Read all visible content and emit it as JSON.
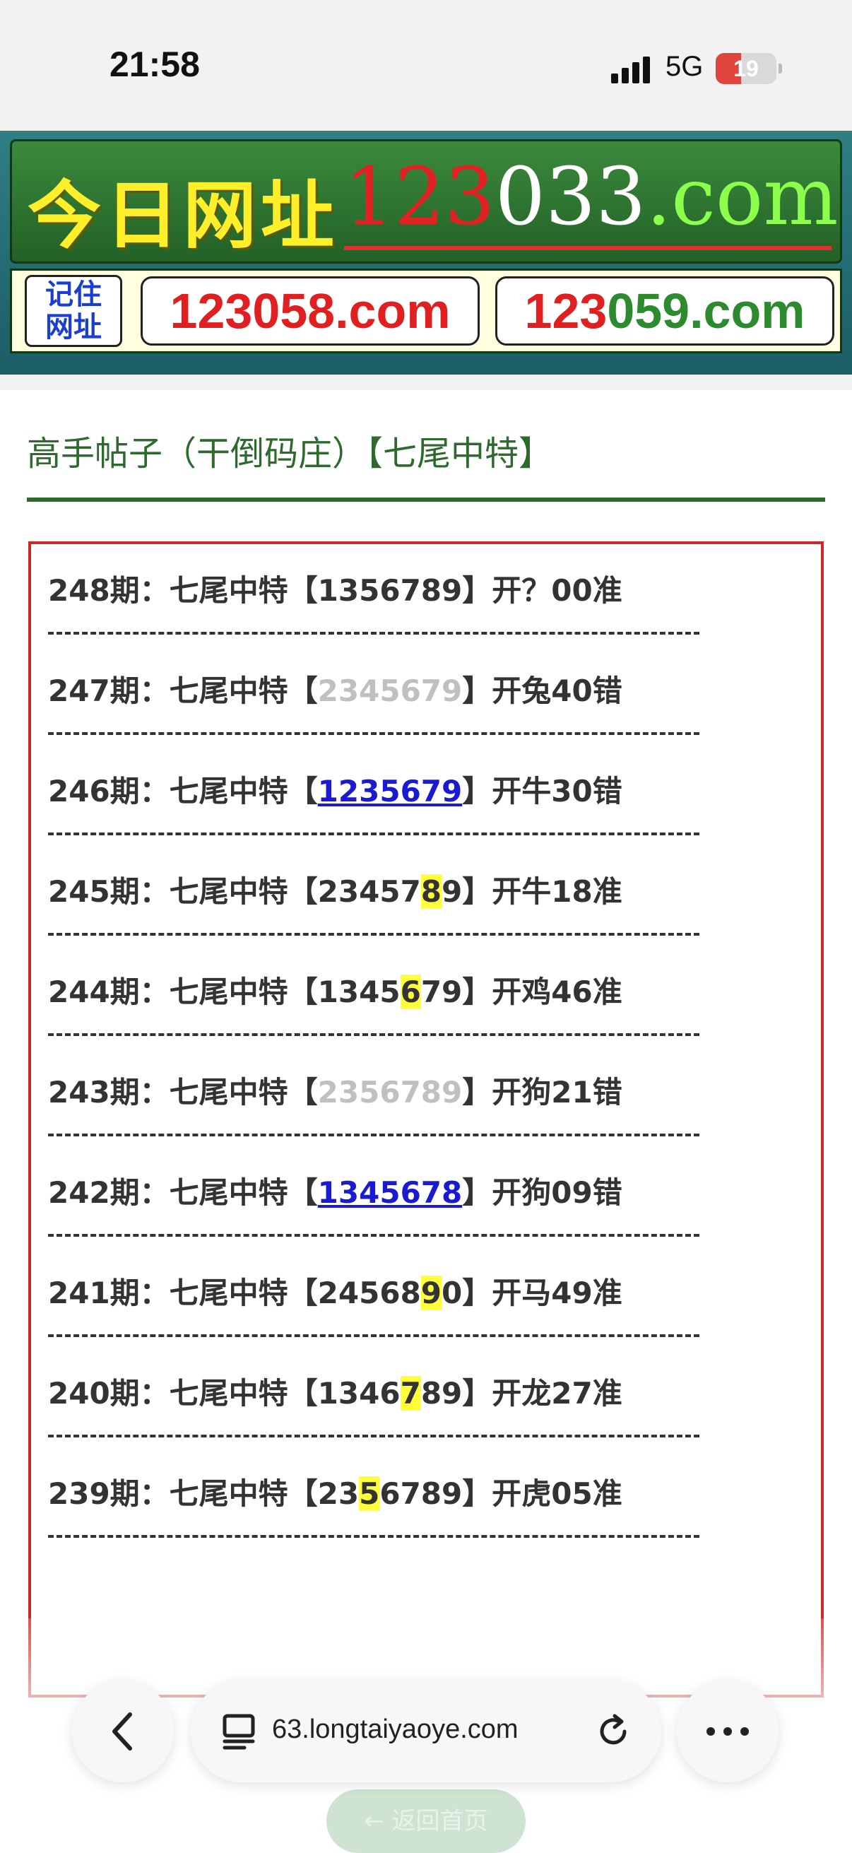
{
  "status_bar": {
    "time": "21:58",
    "network": "5G",
    "battery": "19",
    "icons": [
      "signal-icon",
      "battery-icon"
    ]
  },
  "banner": {
    "title": "今日网址",
    "domain_red": "123",
    "domain_white": "033",
    "domain_green": ".com",
    "remember_line1": "记住",
    "remember_line2": "网址",
    "domain2_red": "123",
    "domain2_green": "058.com",
    "domain3_red": "123",
    "domain3_green": "059.com"
  },
  "page": {
    "heading": "高手帖子（干倒码庄）【七尾中特】"
  },
  "entries": [
    {
      "period": "248期：七尾中特【",
      "nums": "1356789",
      "nums_style": "plain",
      "suffix": "】开？00准"
    },
    {
      "period": "247期：七尾中特【",
      "nums": "2345679",
      "nums_style": "gray",
      "suffix": "】开兔40错"
    },
    {
      "period": "246期：七尾中特【",
      "nums": "1235679",
      "nums_style": "blue",
      "suffix": "】开牛30错"
    },
    {
      "period": "245期：七尾中特【",
      "pre": "23457",
      "hl": "8",
      "post": "9",
      "suffix": "】开牛18准"
    },
    {
      "period": "244期：七尾中特【",
      "pre": "1345",
      "hl": "6",
      "post": "79",
      "suffix": "】开鸡46准"
    },
    {
      "period": "243期：七尾中特【",
      "nums": "2356789",
      "nums_style": "gray",
      "suffix": "】开狗21错"
    },
    {
      "period": "242期：七尾中特【",
      "nums": "1345678",
      "nums_style": "blue",
      "suffix": "】开狗09错"
    },
    {
      "period": "241期：七尾中特【",
      "pre": "24568",
      "hl": "9",
      "post": "0",
      "suffix": "】开马49准"
    },
    {
      "period": "240期：七尾中特【",
      "pre": "1346",
      "hl": "7",
      "post": "89",
      "suffix": "】开龙27准"
    },
    {
      "period": "239期：七尾中特【",
      "pre": "23",
      "hl": "5",
      "post": "6789",
      "suffix": "】开虎05准"
    }
  ],
  "separator": "------------------------------------",
  "browser": {
    "url": "63.longtaiyaoye.com",
    "back_home": "← 返回首页",
    "icons": [
      "back-icon",
      "tabs-icon",
      "reload-icon",
      "more-icon"
    ]
  }
}
